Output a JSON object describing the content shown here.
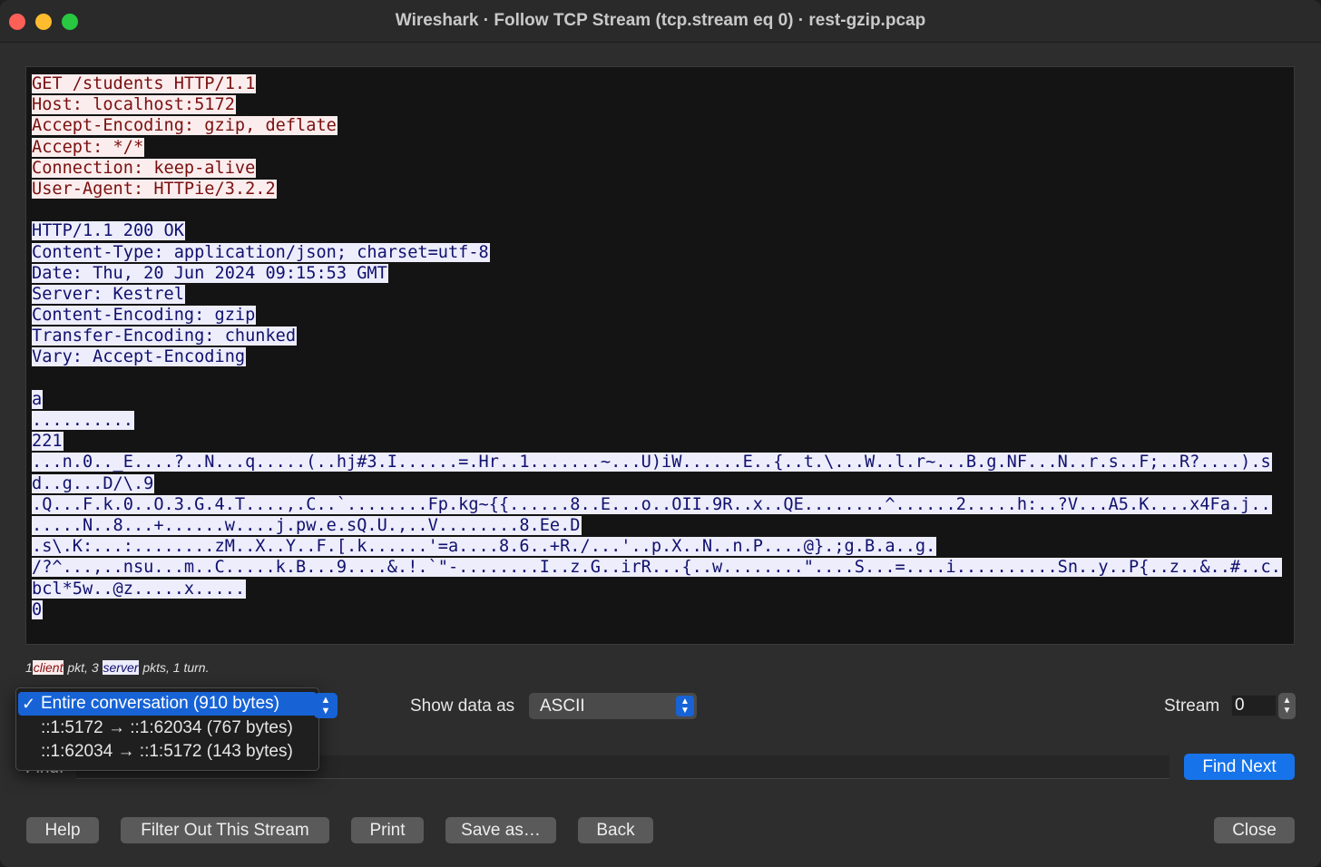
{
  "window": {
    "title": "Wireshark · Follow TCP Stream (tcp.stream eq 0) · rest-gzip.pcap"
  },
  "stream": {
    "client_lines": [
      "GET /students HTTP/1.1",
      "Host: localhost:5172",
      "Accept-Encoding: gzip, deflate",
      "Accept: */*",
      "Connection: keep-alive",
      "User-Agent: HTTPie/3.2.2"
    ],
    "server_header_lines": [
      "HTTP/1.1 200 OK",
      "Content-Type: application/json; charset=utf-8",
      "Date: Thu, 20 Jun 2024 09:15:53 GMT",
      "Server: Kestrel",
      "Content-Encoding: gzip",
      "Transfer-Encoding: chunked",
      "Vary: Accept-Encoding"
    ],
    "server_body_lines": [
      "a",
      "..........",
      "221",
      "...n.0.._E....?..N...q.....(..hj#3.I......=.Hr..1.......~...U)iW......E..{..t.\\...W..l.r~...B.g.NF...N..r.s..F;..R?....).s",
      "d..g...D/\\.9",
      ".Q...F.k.0..O.3.G.4.T....,.C..`........Fp.kg~{{......8..E...o..OII.9R..x..QE........^......2.....h:..?V...A5.K....x4Fa.j..",
      ".....N..8...+......w....j.pw.e.sQ.U.,..V........8.Ee.D",
      ".s\\.K:...:........zM..X..Y..F.[.k......'=a....8.6..+R./...'..p.X..N..n.P....@}.;g.B.a..g.",
      "/?^...,..nsu...m..C.....k.B...9....&.!.`\"-........I..z.G..irR...{..w........\"....S...=....i..........Sn..y..P{..z..&..#..c.",
      "bcl*5w..@z.....x.....",
      "0"
    ]
  },
  "stats": {
    "prefix": "1",
    "client_tag": "client",
    "middle": "pkt, 3",
    "server_tag": "server",
    "suffix": "pkts, 1 turn."
  },
  "conversation": {
    "options": [
      "Entire conversation (910 bytes)",
      "::1:5172 → ::1:62034 (767 bytes)",
      "::1:62034 → ::1:5172 (143 bytes)"
    ],
    "selected_index": 0,
    "checkmark": "✓"
  },
  "controls": {
    "show_data_as_label": "Show data as",
    "show_data_as_value": "ASCII",
    "stream_label": "Stream",
    "stream_value": "0",
    "find_label": "Find:",
    "find_next_label": "Find Next"
  },
  "buttons": {
    "help": "Help",
    "filter_out": "Filter Out This Stream",
    "print": "Print",
    "save_as": "Save as…",
    "back": "Back",
    "close": "Close"
  },
  "colors": {
    "client_bg": "#fbeded",
    "client_fg": "#7a1010",
    "server_bg": "#ededfb",
    "server_fg": "#10106e",
    "accent": "#1673ea"
  }
}
